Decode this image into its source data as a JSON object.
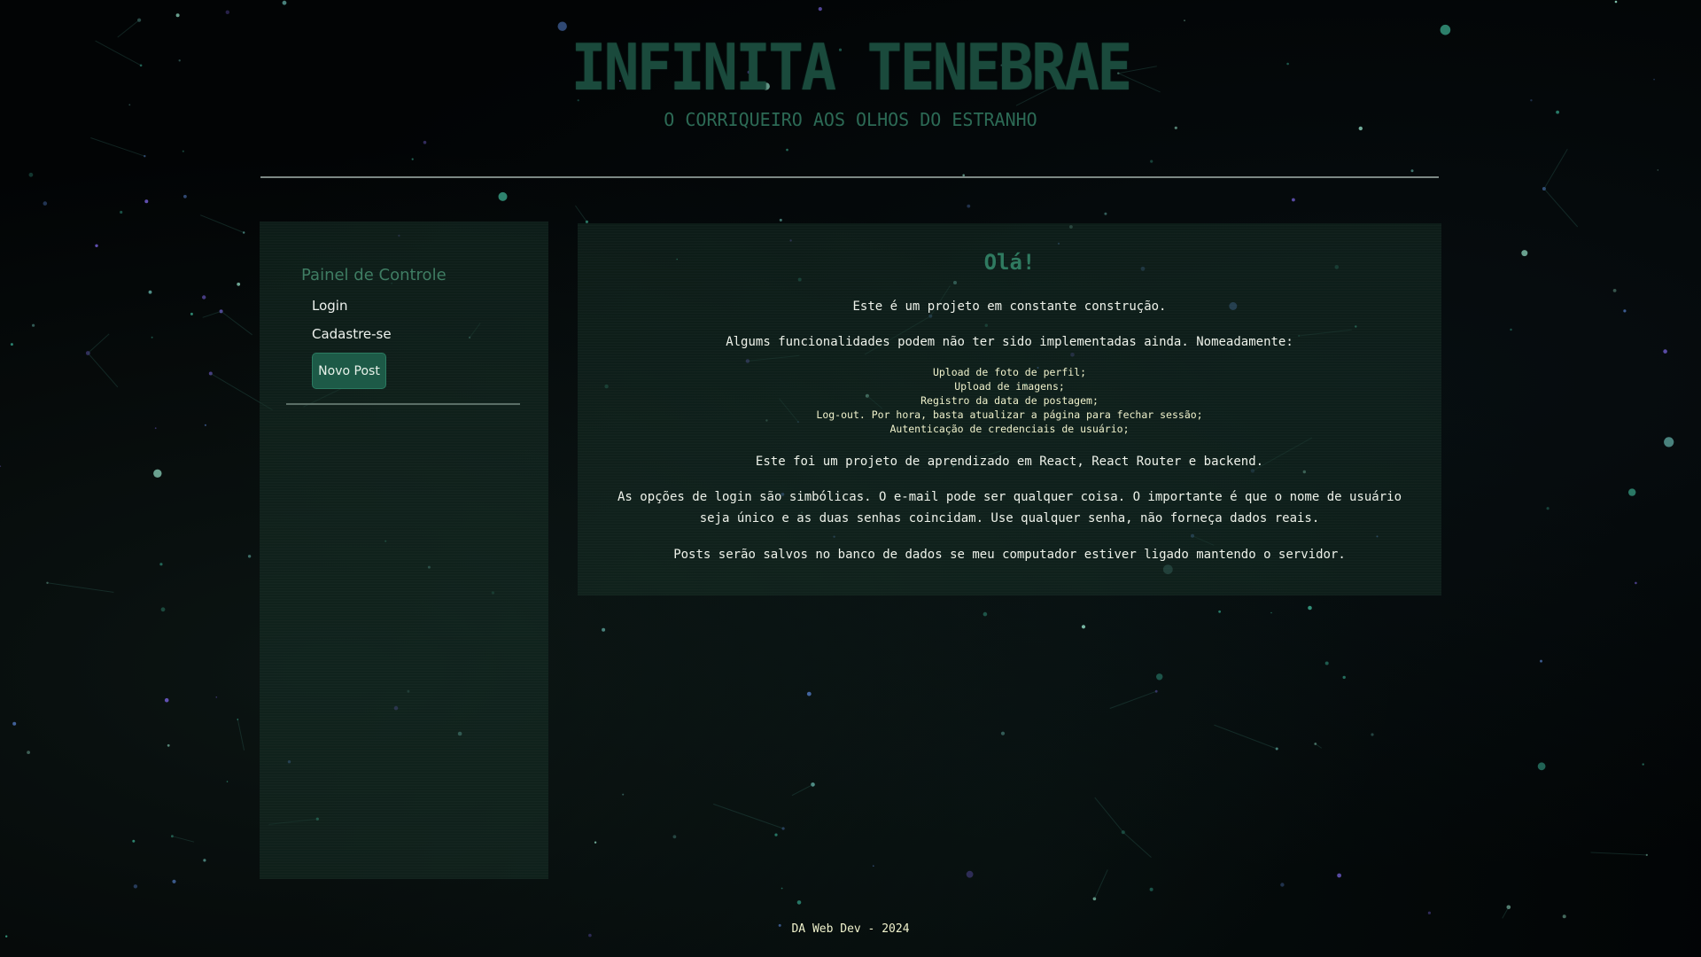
{
  "header": {
    "title": "INFINITA TENEBRAE",
    "subtitle": "O CORRIQUEIRO AOS OLHOS DO ESTRANHO"
  },
  "sidebar": {
    "heading": "Painel de Controle",
    "links": {
      "login": "Login",
      "signup": "Cadastre-se"
    },
    "new_post_label": "Novo Post"
  },
  "main": {
    "greeting": "Olá!",
    "intro": "Este é um projeto em constante construção.",
    "features_intro": "Algums funcionalidades podem não ter sido implementadas ainda. Nomeadamente:",
    "features": [
      "Upload de foto de perfil;",
      "Upload de imagens;",
      "Registro da data de postagem;",
      "Log-out. Por hora, basta atualizar a página para fechar sessão;",
      "Autenticação de credenciais de usuário;"
    ],
    "learning_note": "Este foi um projeto de aprendizado em React, React Router e backend.",
    "login_note": "As opções de login são simbólicas. O e-mail pode ser qualquer coisa. O importante é que o nome de usuário seja único e as duas senhas coincidam. Use qualquer senha, não forneça dados reais.",
    "server_note": "Posts serão salvos no banco de dados se meu computador estiver ligado mantendo o servidor."
  },
  "footer": {
    "text": "DA Web Dev - 2024"
  },
  "colors": {
    "background": "#020405",
    "accent": "#1d5a47",
    "title": "#1a4a3c",
    "text": "#eef2ea"
  }
}
